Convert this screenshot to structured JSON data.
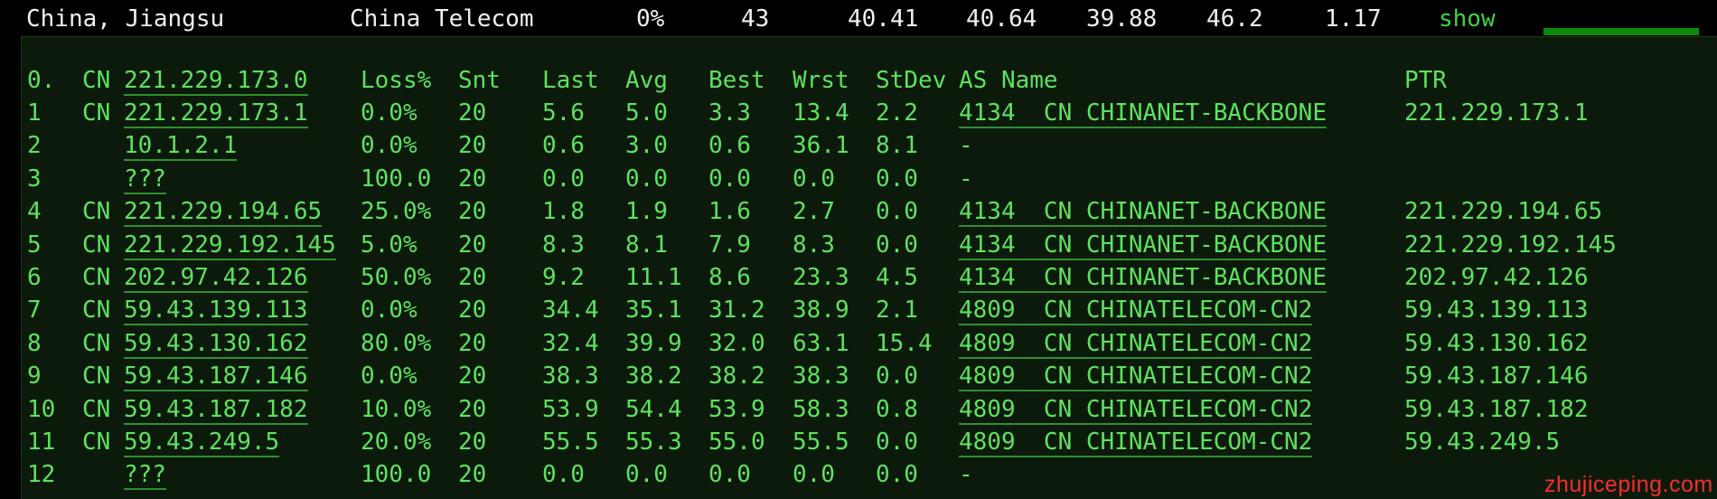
{
  "summary": {
    "location": "China, Jiangsu",
    "isp": "China Telecom",
    "loss": "0%",
    "sent": "43",
    "last": "40.41",
    "avg": "40.64",
    "best": "39.88",
    "worst": "46.2",
    "stdev": "1.17",
    "action": "show"
  },
  "header": {
    "hop": "0.",
    "cc": "CN",
    "host": "221.229.173.0",
    "loss": "Loss%",
    "snt": "Snt",
    "last": "Last",
    "avg": "Avg",
    "best": "Best",
    "wrst": "Wrst",
    "stdev": "StDev",
    "asname": "AS Name",
    "ptr": "PTR"
  },
  "hops": [
    {
      "hop": "1",
      "cc": "CN",
      "host": "221.229.173.1",
      "loss": "0.0%",
      "snt": "20",
      "last": "5.6",
      "avg": "5.0",
      "best": "3.3",
      "wrst": "13.4",
      "stdev": "2.2",
      "as": "4134  CN CHINANET-BACKBONE",
      "ptr": "221.229.173.1"
    },
    {
      "hop": "2",
      "cc": "",
      "host": "10.1.2.1",
      "loss": "0.0%",
      "snt": "20",
      "last": "0.6",
      "avg": "3.0",
      "best": "0.6",
      "wrst": "36.1",
      "stdev": "8.1",
      "as": "-",
      "ptr": ""
    },
    {
      "hop": "3",
      "cc": "",
      "host": "???",
      "loss": "100.0",
      "snt": "20",
      "last": "0.0",
      "avg": "0.0",
      "best": "0.0",
      "wrst": "0.0",
      "stdev": "0.0",
      "as": "-",
      "ptr": ""
    },
    {
      "hop": "4",
      "cc": "CN",
      "host": "221.229.194.65",
      "loss": "25.0%",
      "snt": "20",
      "last": "1.8",
      "avg": "1.9",
      "best": "1.6",
      "wrst": "2.7",
      "stdev": "0.0",
      "as": "4134  CN CHINANET-BACKBONE",
      "ptr": "221.229.194.65"
    },
    {
      "hop": "5",
      "cc": "CN",
      "host": "221.229.192.145",
      "loss": "5.0%",
      "snt": "20",
      "last": "8.3",
      "avg": "8.1",
      "best": "7.9",
      "wrst": "8.3",
      "stdev": "0.0",
      "as": "4134  CN CHINANET-BACKBONE",
      "ptr": "221.229.192.145"
    },
    {
      "hop": "6",
      "cc": "CN",
      "host": "202.97.42.126",
      "loss": "50.0%",
      "snt": "20",
      "last": "9.2",
      "avg": "11.1",
      "best": "8.6",
      "wrst": "23.3",
      "stdev": "4.5",
      "as": "4134  CN CHINANET-BACKBONE",
      "ptr": "202.97.42.126"
    },
    {
      "hop": "7",
      "cc": "CN",
      "host": "59.43.139.113",
      "loss": "0.0%",
      "snt": "20",
      "last": "34.4",
      "avg": "35.1",
      "best": "31.2",
      "wrst": "38.9",
      "stdev": "2.1",
      "as": "4809  CN CHINATELECOM-CN2",
      "ptr": "59.43.139.113"
    },
    {
      "hop": "8",
      "cc": "CN",
      "host": "59.43.130.162",
      "loss": "80.0%",
      "snt": "20",
      "last": "32.4",
      "avg": "39.9",
      "best": "32.0",
      "wrst": "63.1",
      "stdev": "15.4",
      "as": "4809  CN CHINATELECOM-CN2",
      "ptr": "59.43.130.162"
    },
    {
      "hop": "9",
      "cc": "CN",
      "host": "59.43.187.146",
      "loss": "0.0%",
      "snt": "20",
      "last": "38.3",
      "avg": "38.2",
      "best": "38.2",
      "wrst": "38.3",
      "stdev": "0.0",
      "as": "4809  CN CHINATELECOM-CN2",
      "ptr": "59.43.187.146"
    },
    {
      "hop": "10",
      "cc": "CN",
      "host": "59.43.187.182",
      "loss": "10.0%",
      "snt": "20",
      "last": "53.9",
      "avg": "54.4",
      "best": "53.9",
      "wrst": "58.3",
      "stdev": "0.8",
      "as": "4809  CN CHINATELECOM-CN2",
      "ptr": "59.43.187.182"
    },
    {
      "hop": "11",
      "cc": "CN",
      "host": "59.43.249.5",
      "loss": "20.0%",
      "snt": "20",
      "last": "55.5",
      "avg": "55.3",
      "best": "55.0",
      "wrst": "55.5",
      "stdev": "0.0",
      "as": "4809  CN CHINATELECOM-CN2",
      "ptr": "59.43.249.5"
    },
    {
      "hop": "12",
      "cc": "",
      "host": "???",
      "loss": "100.0",
      "snt": "20",
      "last": "0.0",
      "avg": "0.0",
      "best": "0.0",
      "wrst": "0.0",
      "stdev": "0.0",
      "as": "-",
      "ptr": ""
    }
  ],
  "watermark": "zhujiceping.com",
  "colors": {
    "text_green": "#5ee25e",
    "panel_bg": "#0b1a0b",
    "summary_text": "#f0f0f0",
    "watermark": "#ff2b2b",
    "bar": "#0b8a0b"
  }
}
